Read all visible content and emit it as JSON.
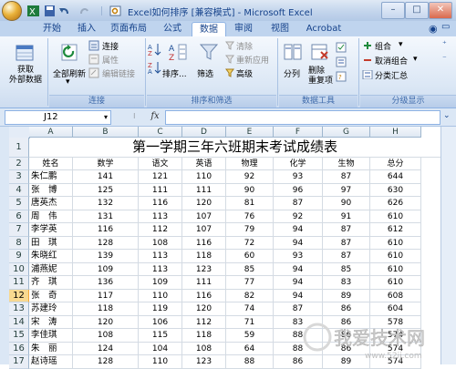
{
  "window": {
    "title": "Excel如何排序 [兼容模式] - Microsoft Excel",
    "minimize": "–",
    "maximize": "□",
    "close": "✕"
  },
  "tabs": [
    "开始",
    "插入",
    "页面布局",
    "公式",
    "数据",
    "审阅",
    "视图",
    "Acrobat"
  ],
  "active_tab": "数据",
  "ribbon": {
    "get_external_label": "获取\n外部数据",
    "refresh_all_label": "全部刷新",
    "connections_label": "连接",
    "properties_label": "属性",
    "edit_links_label": "编辑链接",
    "group_connections": "连接",
    "sort_label": "排序...",
    "filter_label": "筛选",
    "clear_label": "清除",
    "reapply_label": "重新应用",
    "advanced_label": "高级",
    "group_sort_filter": "排序和筛选",
    "text_to_columns_label": "分列",
    "remove_duplicates_label": "删除\n重复项",
    "group_data_tools": "数据工具",
    "group_label": "组合",
    "ungroup_label": "取消组合",
    "subtotal_label": "分类汇总",
    "group_outline": "分级显示"
  },
  "formula_bar": {
    "name_box": "J12",
    "fx": "fx",
    "formula": ""
  },
  "sheet": {
    "columns": [
      "A",
      "B",
      "C",
      "D",
      "E",
      "F",
      "G",
      "H"
    ],
    "title": "第一学期三年六班期末考试成绩表",
    "headers": [
      "姓名",
      "数学",
      "语文",
      "英语",
      "物理",
      "化学",
      "生物",
      "总分"
    ],
    "row_numbers": [
      "1",
      "2",
      "3",
      "4",
      "5",
      "6",
      "7",
      "8",
      "9",
      "10",
      "11",
      "12",
      "13",
      "14",
      "15",
      "16",
      "17"
    ],
    "selected_row": "12",
    "rows": [
      [
        "朱仁鹏",
        "141",
        "121",
        "110",
        "92",
        "93",
        "87",
        "644"
      ],
      [
        "张　博",
        "125",
        "111",
        "111",
        "90",
        "96",
        "97",
        "630"
      ],
      [
        "唐英杰",
        "132",
        "116",
        "120",
        "81",
        "87",
        "90",
        "626"
      ],
      [
        "周　伟",
        "131",
        "113",
        "107",
        "76",
        "92",
        "91",
        "610"
      ],
      [
        "李学英",
        "116",
        "112",
        "107",
        "79",
        "94",
        "87",
        "612"
      ],
      [
        "田　琪",
        "128",
        "108",
        "116",
        "72",
        "94",
        "87",
        "610"
      ],
      [
        "朱晓红",
        "139",
        "113",
        "118",
        "60",
        "93",
        "87",
        "610"
      ],
      [
        "浦燕妮",
        "109",
        "113",
        "123",
        "85",
        "94",
        "85",
        "610"
      ],
      [
        "齐　琪",
        "136",
        "109",
        "111",
        "77",
        "94",
        "83",
        "610"
      ],
      [
        "张　奇",
        "117",
        "110",
        "116",
        "82",
        "94",
        "89",
        "608"
      ],
      [
        "苏建玲",
        "118",
        "119",
        "120",
        "74",
        "87",
        "86",
        "604"
      ],
      [
        "宋　涛",
        "120",
        "106",
        "112",
        "71",
        "83",
        "86",
        "578"
      ],
      [
        "李佳琪",
        "108",
        "115",
        "118",
        "59",
        "88",
        "86",
        "574"
      ],
      [
        "朱　丽",
        "124",
        "104",
        "108",
        "64",
        "88",
        "86",
        "574"
      ],
      [
        "赵诗瑶",
        "128",
        "110",
        "123",
        "88",
        "86",
        "89",
        "574"
      ]
    ]
  },
  "watermark": {
    "text": "我爱技术网",
    "url": "www.52ij.com"
  },
  "colors": {
    "accent": "#15428b",
    "selected_row": "#f8d990"
  }
}
